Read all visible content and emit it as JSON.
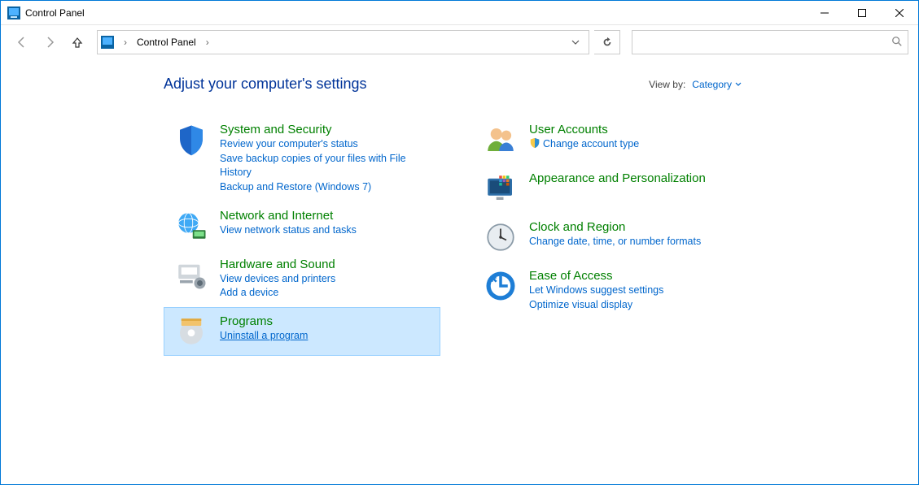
{
  "window": {
    "title": "Control Panel"
  },
  "address": {
    "root": "Control Panel"
  },
  "search": {
    "placeholder": ""
  },
  "heading": "Adjust your computer's settings",
  "viewby": {
    "label": "View by:",
    "value": "Category"
  },
  "left_categories": [
    {
      "id": "system-security",
      "title": "System and Security",
      "links": [
        "Review your computer's status",
        "Save backup copies of your files with File History",
        "Backup and Restore (Windows 7)"
      ]
    },
    {
      "id": "network-internet",
      "title": "Network and Internet",
      "links": [
        "View network status and tasks"
      ]
    },
    {
      "id": "hardware-sound",
      "title": "Hardware and Sound",
      "links": [
        "View devices and printers",
        "Add a device"
      ]
    },
    {
      "id": "programs",
      "title": "Programs",
      "links": [
        "Uninstall a program"
      ],
      "selected": true
    }
  ],
  "right_categories": [
    {
      "id": "user-accounts",
      "title": "User Accounts",
      "links": [
        "Change account type"
      ],
      "shield_on_first": true
    },
    {
      "id": "appearance",
      "title": "Appearance and Personalization",
      "links": []
    },
    {
      "id": "clock-region",
      "title": "Clock and Region",
      "links": [
        "Change date, time, or number formats"
      ]
    },
    {
      "id": "ease-of-access",
      "title": "Ease of Access",
      "links": [
        "Let Windows suggest settings",
        "Optimize visual display"
      ]
    }
  ]
}
